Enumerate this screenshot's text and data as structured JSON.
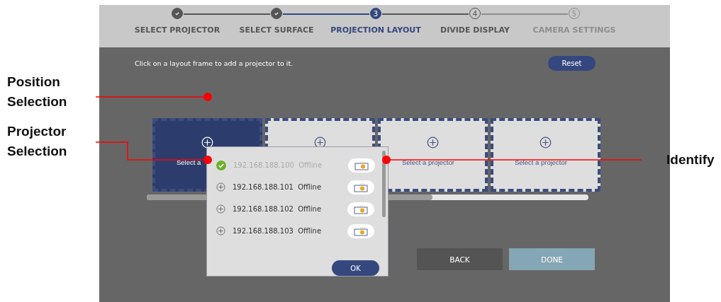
{
  "steps": [
    {
      "label": "SELECT PROJECTOR",
      "completed": true,
      "selected": false,
      "disabled": false
    },
    {
      "label": "SELECT SURFACE",
      "completed": true,
      "selected": false,
      "disabled": false
    },
    {
      "label": "PROJECTION LAYOUT",
      "number": "3",
      "completed": false,
      "selected": true,
      "disabled": false
    },
    {
      "label": "DIVIDE DISPLAY",
      "number": "4",
      "completed": false,
      "selected": false,
      "disabled": false
    },
    {
      "label": "CAMERA SETTINGS",
      "number": "5",
      "completed": false,
      "selected": false,
      "disabled": true
    }
  ],
  "hint": "Click on a layout frame to add a projector to it.",
  "reset_button": "Reset",
  "frames": [
    {
      "label": "Select a",
      "selected": true
    },
    {
      "selected": false
    },
    {
      "label": "Select a projector",
      "selected": false
    },
    {
      "label": "Select a projector",
      "selected": false
    }
  ],
  "projector_list": {
    "items": [
      {
        "address": "192.168.188.100",
        "status": "Offline",
        "selected": true
      },
      {
        "address": "192.168.188.101",
        "status": "Offline",
        "selected": false
      },
      {
        "address": "192.168.188.102",
        "status": "Offline",
        "selected": false
      },
      {
        "address": "192.168.188.103",
        "status": "Offline",
        "selected": false
      }
    ],
    "ok_button": "OK"
  },
  "back_button": "BACK",
  "done_button": "DONE",
  "callouts": [
    {
      "label": "Position Selection"
    },
    {
      "label": "Projector Selection"
    },
    {
      "label": "Identify"
    }
  ]
}
